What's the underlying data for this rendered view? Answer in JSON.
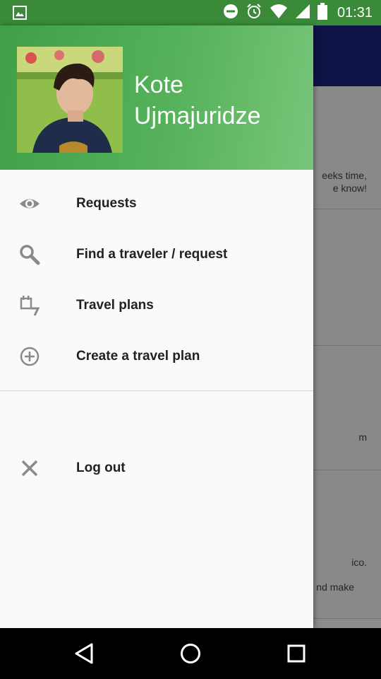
{
  "status_bar": {
    "time": "01:31",
    "icons": [
      "image-icon",
      "do-not-disturb-icon",
      "alarm-icon",
      "wifi-icon",
      "signal-icon",
      "battery-icon"
    ]
  },
  "background_app": {
    "snippets": [
      "eeks time,",
      "e know!",
      "m",
      "ico.",
      "nd make"
    ]
  },
  "drawer": {
    "user_name_line1": "Kote",
    "user_name_line2": "Ujmajuridze",
    "menu": [
      {
        "label": "Requests",
        "icon": "eye-icon"
      },
      {
        "label": "Find a traveler / request",
        "icon": "search-icon"
      },
      {
        "label": "Travel plans",
        "icon": "calendar-icon"
      },
      {
        "label": "Create a travel plan",
        "icon": "add-circle-icon"
      }
    ],
    "logout": {
      "label": "Log out",
      "icon": "close-icon"
    }
  },
  "colors": {
    "header_green": "#4caf50",
    "status_green": "#3a8a3a",
    "toolbar_indigo": "#1a237e",
    "icon_grey": "#8a8a8a"
  },
  "nav_bar": {
    "buttons": [
      "back-icon",
      "home-icon",
      "recents-icon"
    ]
  }
}
